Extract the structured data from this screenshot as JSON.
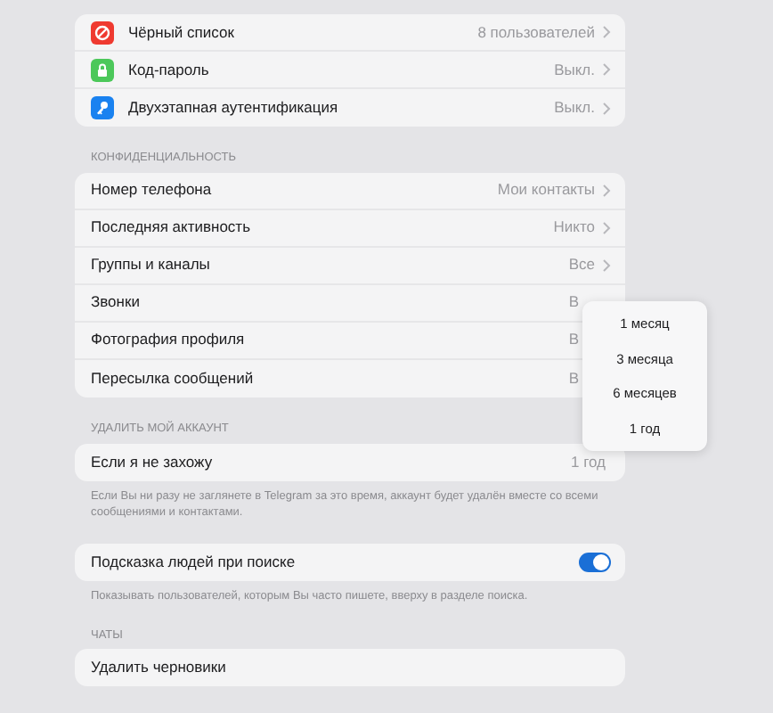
{
  "security": {
    "rows": [
      {
        "label": "Чёрный список",
        "value": "8 пользователей",
        "kind": "link"
      },
      {
        "label": "Код-пароль",
        "value": "Выкл.",
        "kind": "link"
      },
      {
        "label": "Двухэтапная аутентификация",
        "value": "Выкл.",
        "kind": "link"
      }
    ]
  },
  "privacy": {
    "header": "КОНФИДЕНЦИАЛЬНОСТЬ",
    "rows": [
      {
        "label": "Номер телефона",
        "value": "Мои контакты",
        "kind": "link"
      },
      {
        "label": "Последняя активность",
        "value": "Никто",
        "kind": "link"
      },
      {
        "label": "Группы и каналы",
        "value": "Все",
        "kind": "link"
      },
      {
        "label": "Звонки",
        "value": "В",
        "kind": "covered"
      },
      {
        "label": "Фотография профиля",
        "value": "В",
        "kind": "covered"
      },
      {
        "label": "Пересылка сообщений",
        "value": "В",
        "kind": "covered"
      }
    ]
  },
  "delete_account": {
    "header": "УДАЛИТЬ МОЙ АККАУНТ",
    "row": {
      "label": "Если я не захожу",
      "value": "1 год",
      "kind": "plain"
    },
    "footer": "Если Вы ни разу не заглянете в Telegram за это время, аккаунт будет удалён вместе со всеми сообщениями и контактами."
  },
  "suggest": {
    "label": "Подсказка людей при поиске",
    "on": true,
    "footer": "Показывать пользователей, которым Вы часто пишете, вверху в разделе поиска."
  },
  "chats": {
    "header": "ЧАТЫ",
    "row": {
      "label": "Удалить черновики"
    }
  },
  "popup": {
    "options": [
      "1 месяц",
      "3 месяца",
      "6 месяцев",
      "1 год"
    ]
  }
}
